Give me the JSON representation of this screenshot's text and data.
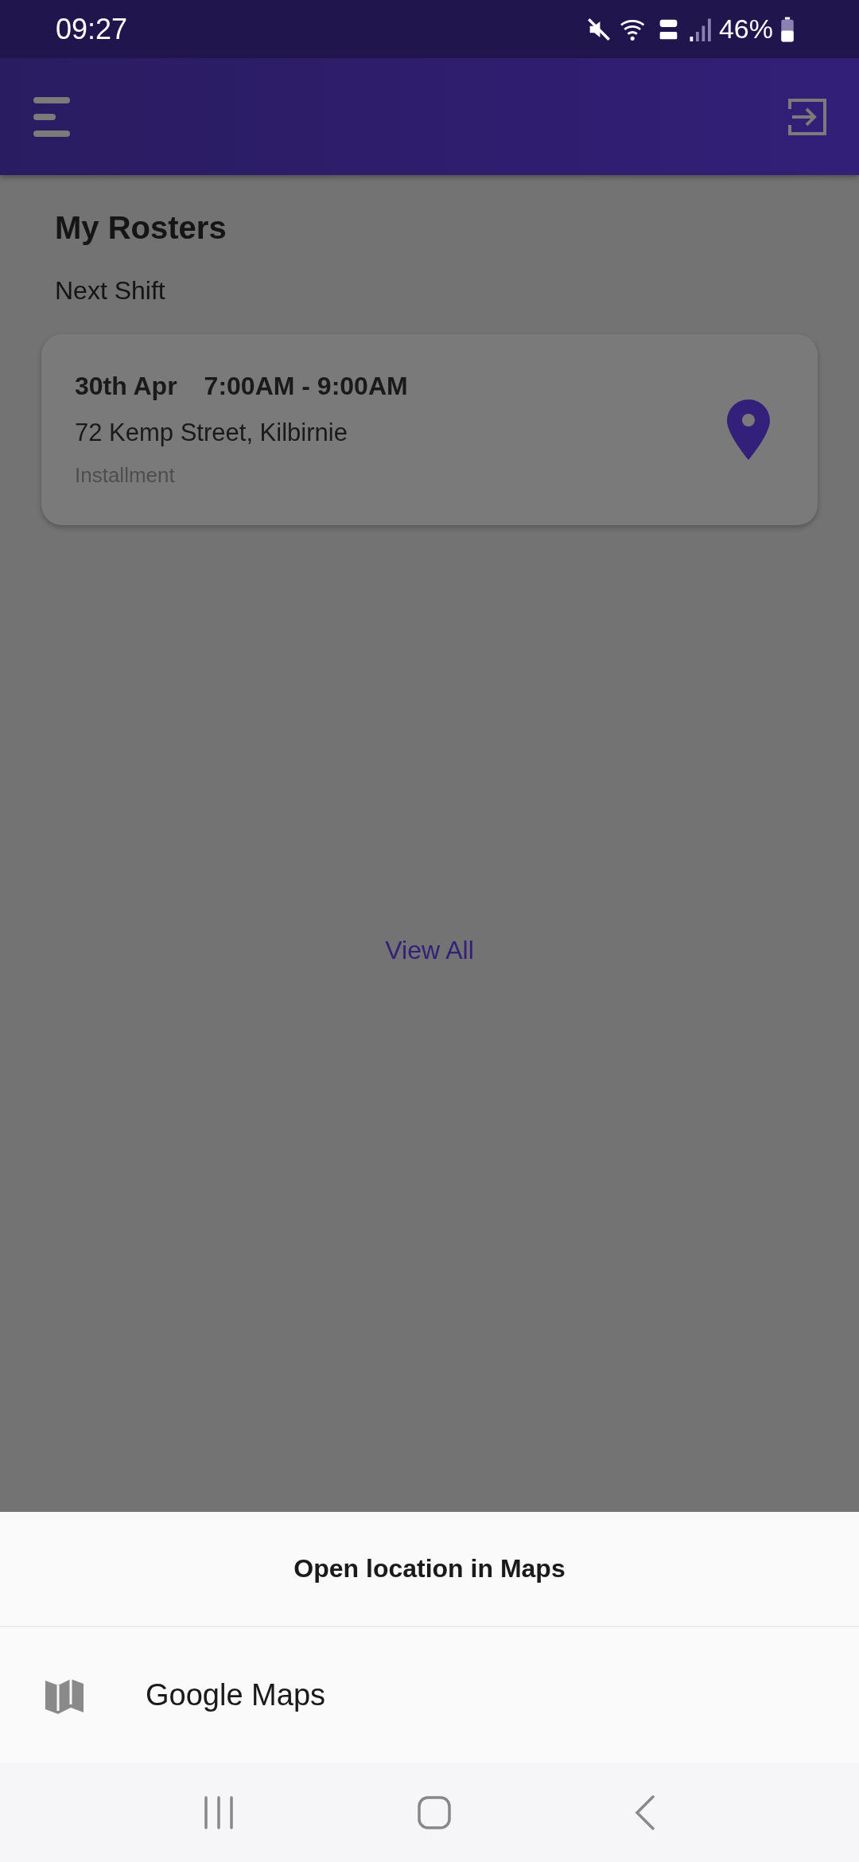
{
  "status_bar": {
    "time": "09:27",
    "battery": "46%"
  },
  "page": {
    "title": "My Rosters",
    "section": "Next Shift"
  },
  "shift": {
    "date": "30th Apr",
    "time": "7:00AM - 9:00AM",
    "address": "72 Kemp Street, Kilbirnie",
    "type": "Installment"
  },
  "view_all": "View All",
  "sheet": {
    "title": "Open location in Maps",
    "options": [
      {
        "label": "Google Maps"
      }
    ]
  }
}
